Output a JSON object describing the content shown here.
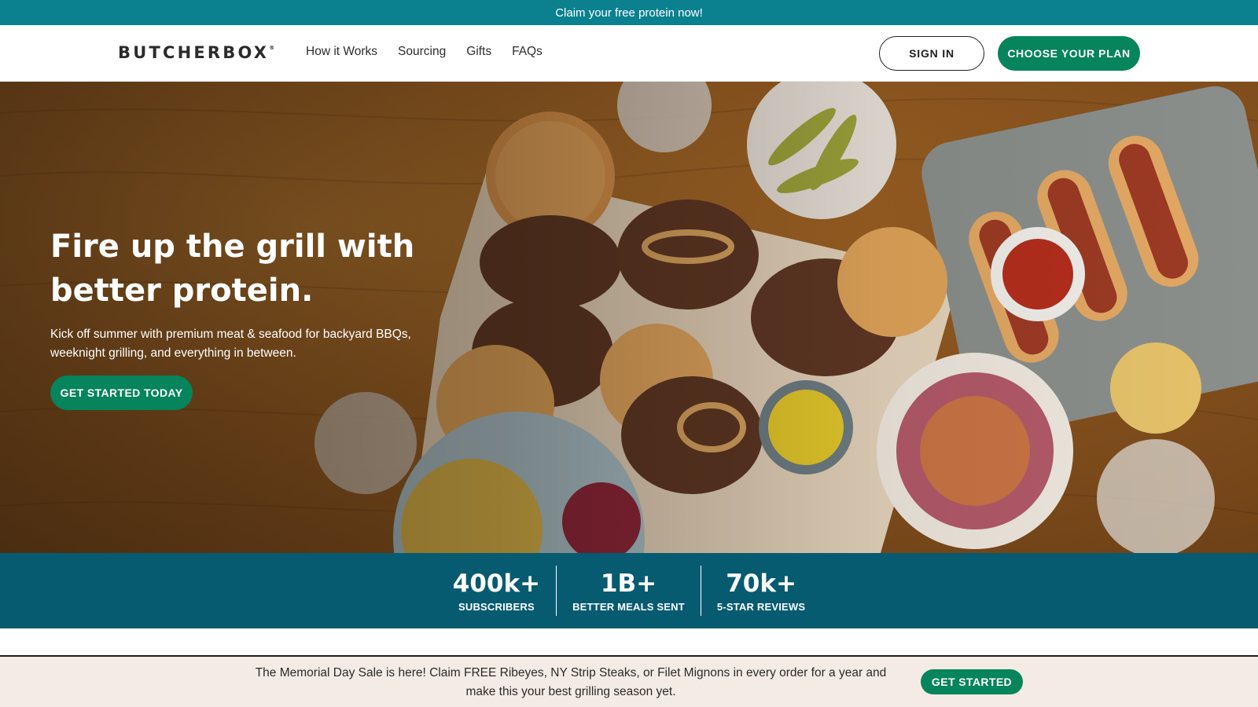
{
  "promo": {
    "text": "Claim your free protein now!"
  },
  "header": {
    "logo": "BUTCHERBOX",
    "logo_mark": "®",
    "nav": [
      {
        "label": "How it Works"
      },
      {
        "label": "Sourcing"
      },
      {
        "label": "Gifts"
      },
      {
        "label": "FAQs"
      }
    ],
    "sign_in_label": "SIGN IN",
    "choose_plan_label": "CHOOSE YOUR PLAN"
  },
  "hero": {
    "title": "Fire up the grill with better protein.",
    "subtitle": "Kick off summer with premium meat & seafood for backyard BBQs, weeknight grilling, and everything in between.",
    "cta_label": "GET STARTED TODAY"
  },
  "stats": [
    {
      "value": "400k+",
      "label": "SUBSCRIBERS"
    },
    {
      "value": "1B+",
      "label": "BETTER MEALS SENT"
    },
    {
      "value": "70k+",
      "label": "5-STAR REVIEWS"
    }
  ],
  "sale_bar": {
    "text": "The Memorial Day Sale is here! Claim FREE Ribeyes, NY Strip Steaks, or Filet Mignons in every order for a year and make this your best grilling season yet.",
    "cta_label": "GET STARTED"
  },
  "colors": {
    "promo_bg": "#0b8190",
    "brand_green": "#06845b",
    "stats_bg": "#075b71",
    "sale_bg": "#f4ece4"
  }
}
